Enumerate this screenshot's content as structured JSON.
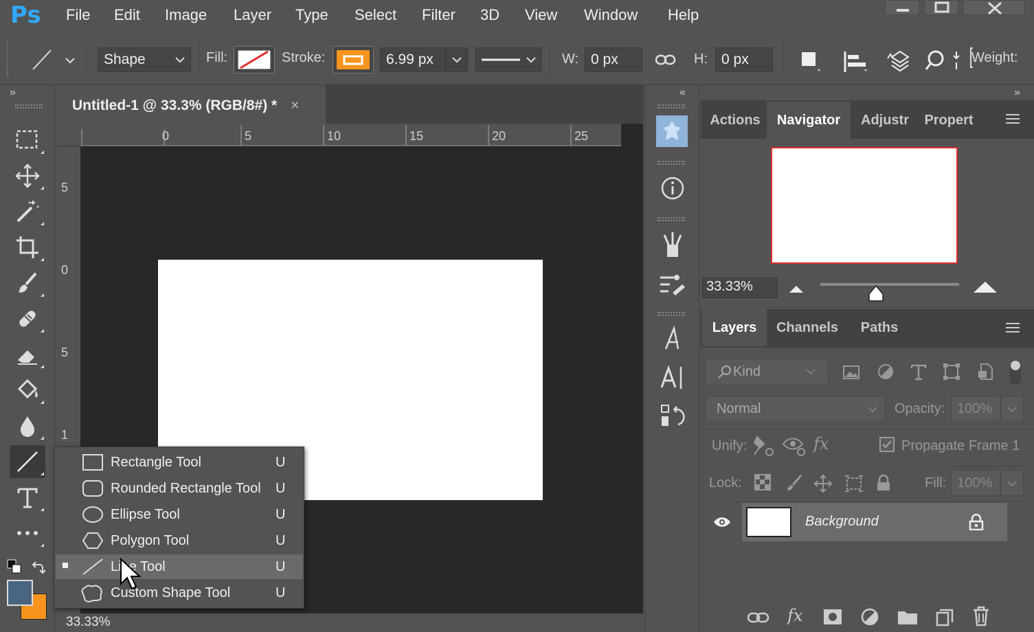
{
  "app": {
    "logo": "Ps"
  },
  "menu": [
    "File",
    "Edit",
    "Image",
    "Layer",
    "Type",
    "Select",
    "Filter",
    "3D",
    "View",
    "Window",
    "Help"
  ],
  "options": {
    "mode": "Shape",
    "fill_label": "Fill:",
    "stroke_label": "Stroke:",
    "stroke_width": "6.99 px",
    "w_label": "W:",
    "w_value": "0 px",
    "h_label": "H:",
    "h_value": "0 px",
    "weight_label": "Weight:",
    "stroke_color": "#f7941d"
  },
  "document": {
    "tab_title": "Untitled-1 @ 33.3% (RGB/8#) *",
    "close_glyph": "×",
    "zoom_status": "33.33%",
    "h_ruler": [
      "0",
      "5",
      "10",
      "15",
      "20",
      "25"
    ],
    "v_ruler": [
      "5",
      "0",
      "5",
      "1"
    ]
  },
  "flyout": {
    "items": [
      {
        "label": "Rectangle Tool",
        "key": "U",
        "active": false
      },
      {
        "label": "Rounded Rectangle Tool",
        "key": "U",
        "active": false
      },
      {
        "label": "Ellipse Tool",
        "key": "U",
        "active": false
      },
      {
        "label": "Polygon Tool",
        "key": "U",
        "active": false
      },
      {
        "label": "Line Tool",
        "key": "U",
        "active": true
      },
      {
        "label": "Custom Shape Tool",
        "key": "U",
        "active": false
      }
    ]
  },
  "navigator": {
    "tabs": [
      "Actions",
      "Navigator",
      "Adjustr",
      "Propert"
    ],
    "active_tab": "Navigator",
    "zoom": "33.33%",
    "zoom_slider_fraction": 0.4
  },
  "layers": {
    "tabs": [
      "Layers",
      "Channels",
      "Paths"
    ],
    "filter_kind": "Kind",
    "blend_mode": "Normal",
    "opacity_label": "Opacity:",
    "opacity": "100%",
    "unify_label": "Unify:",
    "propagate_label": "Propagate Frame 1",
    "lock_label": "Lock:",
    "fill_label": "Fill:",
    "fill": "100%",
    "rows": [
      {
        "name": "Background",
        "visible": true,
        "locked": true
      }
    ]
  },
  "colors": {
    "foreground": "#4a6580",
    "background": "#f7941d",
    "accent": "#31a8ff"
  }
}
